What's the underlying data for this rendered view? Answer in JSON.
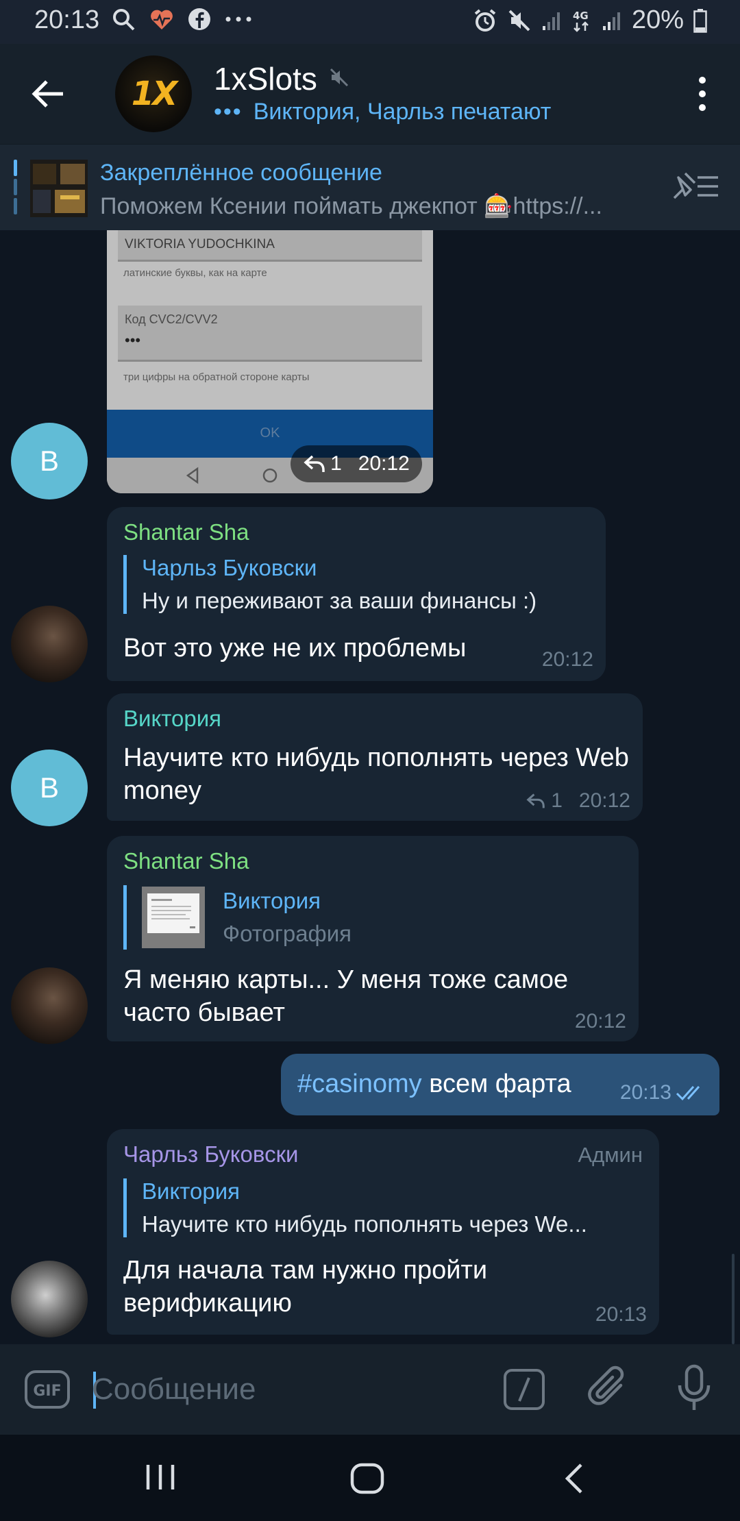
{
  "status_bar": {
    "time": "20:13",
    "battery": "20%",
    "network": "4G"
  },
  "header": {
    "title": "1xSlots",
    "avatar_text": "1X",
    "typing_dots": "•••",
    "subtitle": "Виктория, Чарльз печатают"
  },
  "pinned": {
    "title": "Закреплённое сообщение",
    "text": "Поможем Ксении поймать джекпот 🎰https://..."
  },
  "photo_message": {
    "name_field": "VIKTORIA YUDOCHKINA",
    "name_hint": "латинские буквы, как на карте",
    "cvc_label": "Код CVC2/CVV2",
    "cvc_value": "•••",
    "cvc_hint": "три цифры на обратной стороне карты",
    "ok_label": "OK",
    "reply_count": "1",
    "time": "20:12",
    "avatar_letter": "В"
  },
  "messages": [
    {
      "sender": "Shantar Sha",
      "reply_name": "Чарльз Буковски",
      "reply_text": "Ну и переживают за ваши финансы :)",
      "text": "Вот это уже не их проблемы",
      "time": "20:12"
    },
    {
      "sender": "Виктория",
      "text": "Научите кто нибудь пополнять через Web money",
      "reply_count": "1",
      "time": "20:12",
      "avatar_letter": "В"
    },
    {
      "sender": "Shantar Sha",
      "reply_name": "Виктория",
      "reply_text": "Фотография",
      "text": "Я меняю карты... У меня тоже самое часто бывает",
      "time": "20:12"
    },
    {
      "hashtag": "#casinomy",
      "text": " всем фарта",
      "time": "20:13"
    },
    {
      "sender": "Чарльз Буковски",
      "badge": "Админ",
      "reply_name": "Виктория",
      "reply_text": "Научите кто нибудь пополнять через We...",
      "text": "Для начала там нужно пройти верификацию",
      "time": "20:13"
    }
  ],
  "input": {
    "placeholder": "Сообщение",
    "gif_label": "GIF"
  },
  "colors": {
    "background": "#0e1621",
    "bubble_in": "#182533",
    "bubble_out": "#2b5278",
    "accent": "#5eb5f7",
    "sender_green": "#7ee082",
    "sender_teal": "#56d6c8",
    "sender_purple": "#a695e7"
  }
}
